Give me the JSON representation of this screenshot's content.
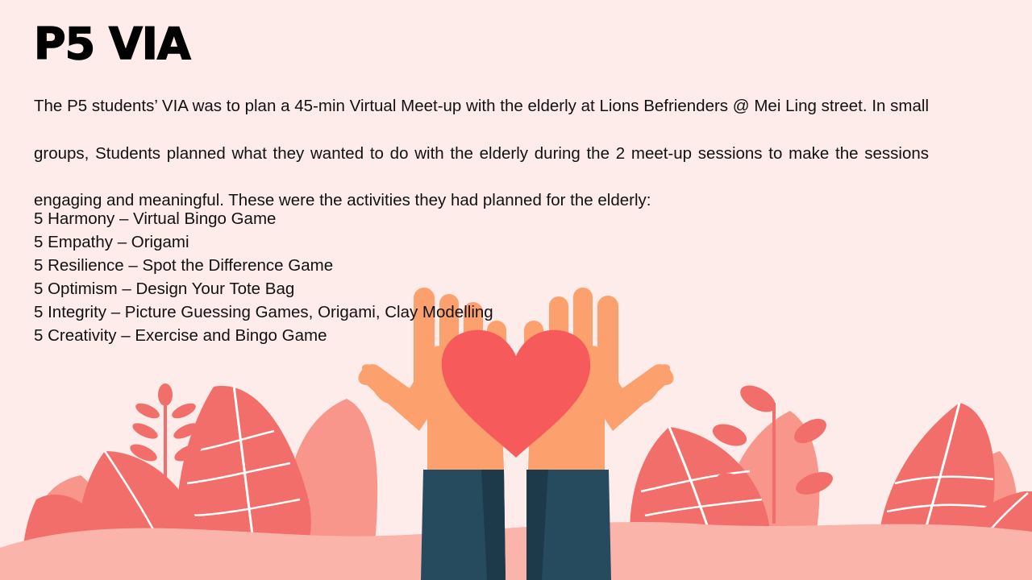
{
  "slide": {
    "title": "P5 VIA",
    "intro": "The P5 students’ VIA was to plan a 45-min Virtual Meet-up with the elderly at Lions Befrienders @ Mei Ling street.  In small groups, Students planned what they wanted to do with the elderly during the 2 meet-up sessions to make the sessions engaging and meaningful. These were the activities they had planned for the elderly:",
    "activities": [
      "5 Harmony – Virtual Bingo Game",
      "5 Empathy – Origami",
      "5 Resilience – Spot the Difference Game",
      "5 Optimism – Design Your Tote Bag",
      "5 Integrity – Picture Guessing Games, Origami, Clay Modelling",
      "5 Creativity – Exercise and Bingo Game"
    ]
  },
  "colors": {
    "background": "#fdecea",
    "heart": "#f65a5a",
    "hands": "#fca06e",
    "sleeves": "#264b5f",
    "leaves_dark": "#f26e6a",
    "leaves_light": "#f9968c",
    "ground": "#fbb4aa"
  },
  "illustration": {
    "icons": [
      "heart-icon",
      "open-hands-icon",
      "leaf-icon",
      "flower-sprig-icon"
    ]
  }
}
